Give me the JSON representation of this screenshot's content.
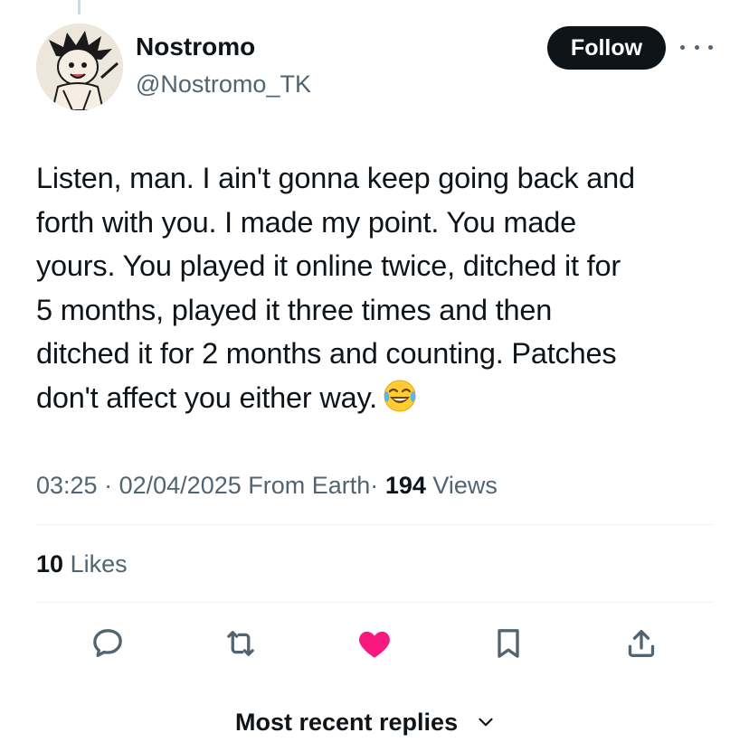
{
  "author": {
    "display_name": "Nostromo",
    "handle": "@Nostromo_TK",
    "avatar_icon": "cartoon-boy-avatar"
  },
  "follow_label": "Follow",
  "tweet": {
    "text": "Listen, man. I ain't gonna keep going back and\nforth with you. I made my point. You made\nyours.  You played it online twice, ditched it for\n5 months, played it three times and then\nditched it for 2 months and counting. Patches\ndon't affect you either way.",
    "emoji": "face-with-tears-of-joy"
  },
  "meta": {
    "time": "03:25",
    "separator": "·",
    "date": "02/04/2025",
    "location": "From Earth",
    "views_count": "194",
    "views_label": "Views"
  },
  "likes": {
    "count": "10",
    "label": "Likes"
  },
  "actions": {
    "reply_icon": "reply-icon",
    "retweet_icon": "retweet-icon",
    "like_icon": "like-icon",
    "bookmark_icon": "bookmark-icon",
    "share_icon": "share-icon",
    "like_active": true
  },
  "colors": {
    "primary_text": "#0f1419",
    "secondary_text": "#536471",
    "like_pink": "#f91880",
    "divider": "#eff3f4"
  },
  "replies_sort": {
    "label": "Most recent replies"
  }
}
